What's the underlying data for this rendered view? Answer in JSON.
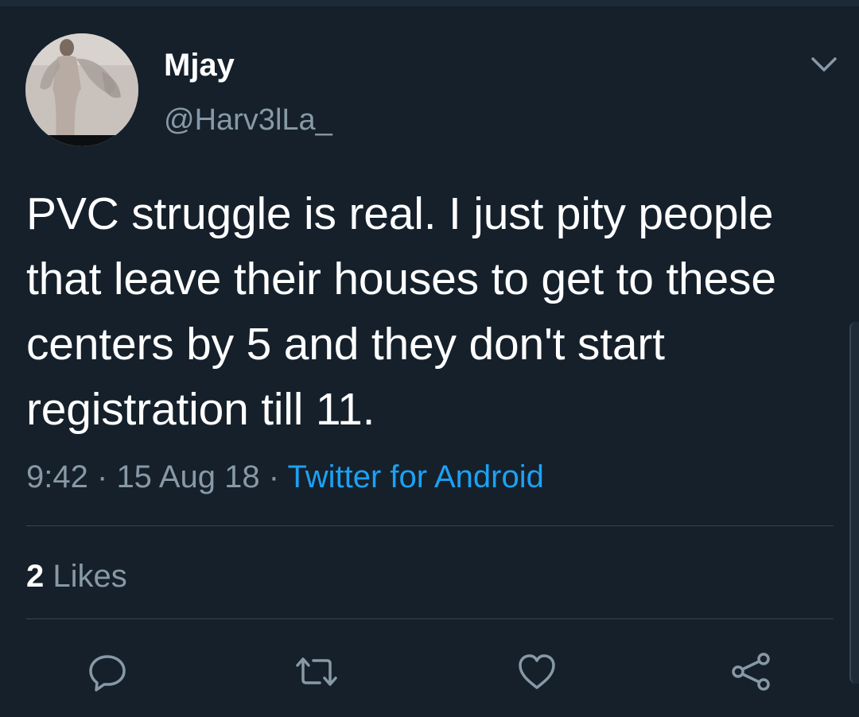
{
  "tweet": {
    "author_name": "Mjay",
    "author_handle": "@Harv3lLa_",
    "text": "PVC struggle is real. I just pity people that leave their houses to get to these centers by 5 and they don't start registration till 11.",
    "time": "9:42",
    "date": "15 Aug 18",
    "separator": "·",
    "source": "Twitter for Android",
    "likes_count": "2",
    "likes_label": "Likes"
  },
  "icons": {
    "menu": "chevron-down-icon",
    "reply": "reply-icon",
    "retweet": "retweet-icon",
    "like": "heart-icon",
    "share": "share-icon"
  },
  "colors": {
    "background": "#15202b",
    "primary_text": "#ffffff",
    "secondary_text": "#8899a6",
    "link": "#1da1f2",
    "divider": "#38444d"
  }
}
